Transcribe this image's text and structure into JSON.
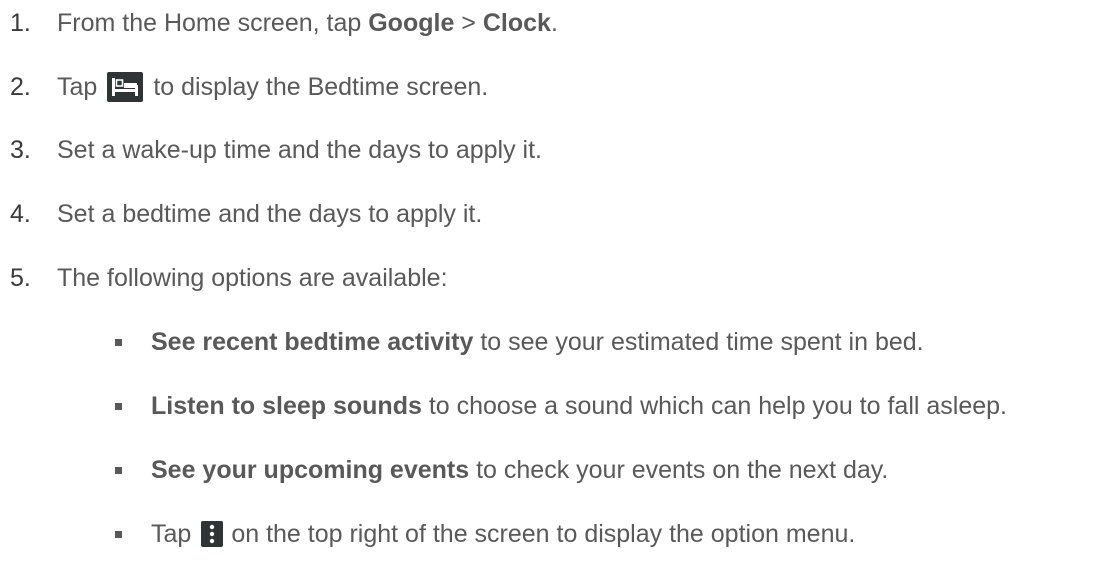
{
  "steps": [
    {
      "num": "1.",
      "pre": "From the Home screen, tap ",
      "bold1": "Google",
      "mid": " > ",
      "bold2": "Clock",
      "post": "."
    },
    {
      "num": "2.",
      "pre": "Tap",
      "icon": "bed-icon",
      "post": "to display the Bedtime screen."
    },
    {
      "num": "3.",
      "text": "Set a wake-up time and the days to apply it."
    },
    {
      "num": "4.",
      "text": "Set a bedtime and the days to apply it."
    },
    {
      "num": "5.",
      "text": "The following options are available:"
    }
  ],
  "bullets": [
    {
      "bold": "See recent bedtime activity",
      "text": " to see your estimated time spent in bed."
    },
    {
      "bold": "Listen to sleep sounds",
      "text": " to choose a sound which can help you to fall asleep."
    },
    {
      "bold": "See your upcoming events",
      "text": " to check your events on the next day."
    },
    {
      "pre": "Tap",
      "icon": "more-vertical-icon",
      "post": "on the top right of the screen to display the option menu."
    }
  ]
}
